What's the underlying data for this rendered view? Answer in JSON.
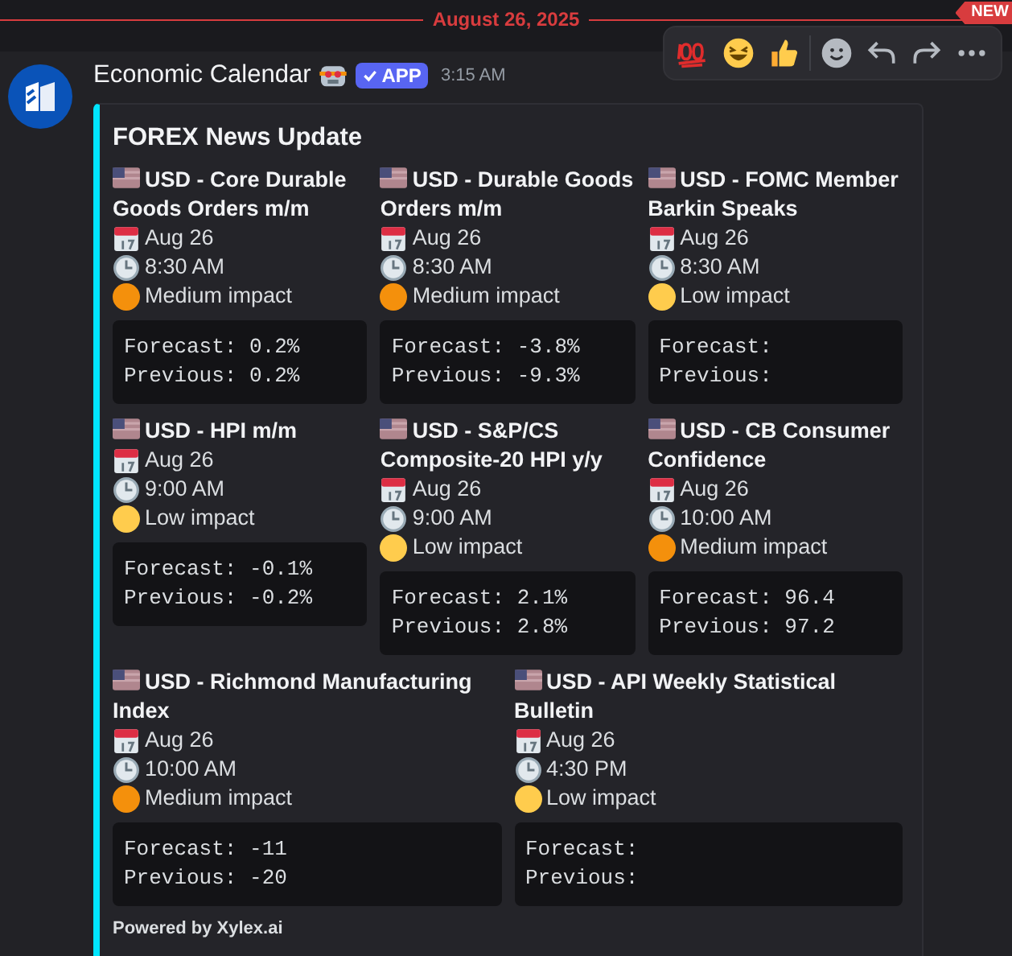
{
  "divider": {
    "date": "August 26, 2025",
    "new_badge": "NEW"
  },
  "message": {
    "author": "Economic Calendar",
    "badge": "APP",
    "time": "3:15 AM",
    "embed": {
      "title": "FOREX News Update",
      "rows": [
        [
          {
            "title": "USD - Core Durable Goods Orders m/m",
            "date": "Aug 26",
            "time": "8:30 AM",
            "impact": "Medium impact",
            "color": "#f4900c",
            "forecast": "Forecast: 0.2%",
            "previous": "Previous: 0.2%"
          },
          {
            "title": "USD - Durable Goods Orders m/m",
            "date": "Aug 26",
            "time": "8:30 AM",
            "impact": "Medium impact",
            "color": "#f4900c",
            "forecast": "Forecast: -3.8%",
            "previous": "Previous: -9.3%"
          },
          {
            "title": "USD - FOMC Member Barkin Speaks",
            "date": "Aug 26",
            "time": "8:30 AM",
            "impact": "Low impact",
            "color": "#ffcc4d",
            "forecast": "Forecast:",
            "previous": "Previous:"
          }
        ],
        [
          {
            "title": "USD - HPI m/m",
            "date": "Aug 26",
            "time": "9:00 AM",
            "impact": "Low impact",
            "color": "#ffcc4d",
            "forecast": "Forecast: -0.1%",
            "previous": "Previous: -0.2%"
          },
          {
            "title": "USD - S&P/CS Composite-20 HPI y/y",
            "date": "Aug 26",
            "time": "9:00 AM",
            "impact": "Low impact",
            "color": "#ffcc4d",
            "forecast": "Forecast: 2.1%",
            "previous": "Previous: 2.8%"
          },
          {
            "title": "USD - CB Consumer Confidence",
            "date": "Aug 26",
            "time": "10:00 AM",
            "impact": "Medium impact",
            "color": "#f4900c",
            "forecast": "Forecast: 96.4",
            "previous": "Previous: 97.2"
          }
        ],
        [
          {
            "title": "USD - Richmond Manufacturing Index",
            "date": "Aug 26",
            "time": "10:00 AM",
            "impact": "Medium impact",
            "color": "#f4900c",
            "forecast": "Forecast: -11",
            "previous": "Previous: -20"
          },
          {
            "title": "USD - API Weekly Statistical Bulletin",
            "date": "Aug 26",
            "time": "4:30 PM",
            "impact": "Low impact",
            "color": "#ffcc4d",
            "forecast": "Forecast:",
            "previous": "Previous:"
          }
        ]
      ],
      "footer": "Powered by Xylex.ai"
    }
  }
}
